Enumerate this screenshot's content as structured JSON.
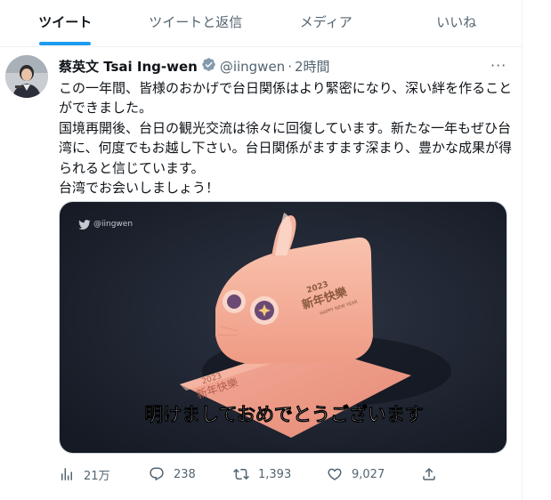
{
  "tabs": [
    {
      "label": "ツイート",
      "active": true
    },
    {
      "label": "ツイートと返信",
      "active": false
    },
    {
      "label": "メディア",
      "active": false
    },
    {
      "label": "いいね",
      "active": false
    }
  ],
  "tweet": {
    "author_name": "蔡英文 Tsai Ing-wen",
    "handle": "@iingwen",
    "separator": "·",
    "time": "2時間",
    "text_lines": [
      "この一年間、皆様のおかげで台日関係はより緊密になり、深い絆を作ることができました。",
      "国境再開後、台日の観光交流は徐々に回復しています。新たな一年もぜひ台湾に、何度でもお越し下さい。台日関係がますます深まり、豊かな成果が得られると信じています。",
      "台湾でお会いしましょう！"
    ],
    "media": {
      "watermark": "@iingwen",
      "caption": "明けましておめでとうございます",
      "card_text_main": "新年快樂",
      "card_text_year": "2023",
      "card_text_en": "HAPPY NEW YEAR",
      "envelope_text_main": "新年快樂",
      "envelope_text_year": "2023"
    },
    "stats": {
      "views": "21万",
      "replies": "238",
      "retweets": "1,393",
      "likes": "9,027"
    }
  },
  "colors": {
    "accent": "#1d9bf0",
    "secondary_text": "#536471",
    "media_bg": "#1f2633",
    "card_peach": "#f4a791"
  },
  "icons": [
    "verified-badge-icon",
    "more-options-icon",
    "views-icon",
    "reply-icon",
    "retweet-icon",
    "like-icon",
    "share-icon",
    "bird-icon"
  ]
}
